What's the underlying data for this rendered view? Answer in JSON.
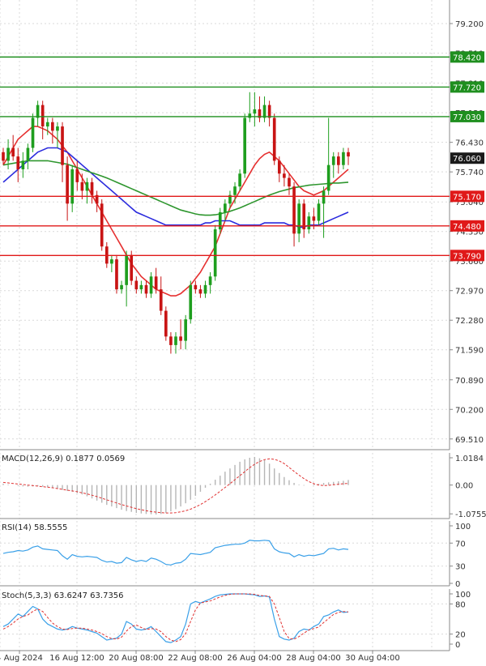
{
  "chart_data": {
    "type": "candlestick",
    "price_axis": {
      "tick_labels": [
        "79.200",
        "78.510",
        "77.810",
        "77.120",
        "76.430",
        "75.740",
        "75.040",
        "74.350",
        "73.660",
        "72.970",
        "72.280",
        "71.590",
        "70.890",
        "70.200",
        "69.510"
      ],
      "ylim": [
        69.26,
        79.75
      ]
    },
    "x_axis": {
      "tick_labels": [
        "4 Aug 2024",
        "16 Aug 12:00",
        "20 Aug 08:00",
        "22 Aug 08:00",
        "26 Aug 04:00",
        "28 Aug 04:00",
        "30 Aug 04:00"
      ]
    },
    "levels": [
      {
        "label": "78.420",
        "value": 78.42,
        "color": "#1f8f1f"
      },
      {
        "label": "77.720",
        "value": 77.72,
        "color": "#1f8f1f"
      },
      {
        "label": "77.030",
        "value": 77.03,
        "color": "#1f8f1f"
      },
      {
        "label": "75.170",
        "value": 75.17,
        "color": "#e01919"
      },
      {
        "label": "74.480",
        "value": 74.48,
        "color": "#e01919"
      },
      {
        "label": "73.790",
        "value": 73.79,
        "color": "#e01919"
      }
    ],
    "current_price": {
      "label": "76.060",
      "value": 76.06
    },
    "candles": [
      [
        76.2,
        76.3,
        75.9,
        76.0
      ],
      [
        76.0,
        76.5,
        75.8,
        76.3
      ],
      [
        76.3,
        76.6,
        76.0,
        76.1
      ],
      [
        76.1,
        76.3,
        75.5,
        75.8
      ],
      [
        75.8,
        76.2,
        75.6,
        76.0
      ],
      [
        76.0,
        76.4,
        75.8,
        76.3
      ],
      [
        76.3,
        77.1,
        76.2,
        77.0
      ],
      [
        77.0,
        77.4,
        76.8,
        77.3
      ],
      [
        77.3,
        77.4,
        76.5,
        76.8
      ],
      [
        76.8,
        77.0,
        76.6,
        76.9
      ],
      [
        76.9,
        77.0,
        76.4,
        76.7
      ],
      [
        76.7,
        76.9,
        76.3,
        76.8
      ],
      [
        76.8,
        76.9,
        75.5,
        75.9
      ],
      [
        75.9,
        76.1,
        74.6,
        75.0
      ],
      [
        75.0,
        75.9,
        74.8,
        75.8
      ],
      [
        75.8,
        76.0,
        75.3,
        75.5
      ],
      [
        75.5,
        75.7,
        75.1,
        75.3
      ],
      [
        75.3,
        75.6,
        75.0,
        75.5
      ],
      [
        75.5,
        75.6,
        75.0,
        75.2
      ],
      [
        75.2,
        75.3,
        74.8,
        75.0
      ],
      [
        75.0,
        75.1,
        73.9,
        74.0
      ],
      [
        74.0,
        74.1,
        73.5,
        73.6
      ],
      [
        73.6,
        73.8,
        73.4,
        73.7
      ],
      [
        73.7,
        73.8,
        72.9,
        73.0
      ],
      [
        73.0,
        73.2,
        72.9,
        73.1
      ],
      [
        73.1,
        73.9,
        72.6,
        73.8
      ],
      [
        73.8,
        73.9,
        73.1,
        73.2
      ],
      [
        73.2,
        73.3,
        72.9,
        73.0
      ],
      [
        73.0,
        73.2,
        72.9,
        73.1
      ],
      [
        73.1,
        73.2,
        72.8,
        72.9
      ],
      [
        72.9,
        73.4,
        72.8,
        73.3
      ],
      [
        73.3,
        73.5,
        72.9,
        73.0
      ],
      [
        73.0,
        73.3,
        72.4,
        72.5
      ],
      [
        72.5,
        72.6,
        71.8,
        71.9
      ],
      [
        71.9,
        72.0,
        71.5,
        71.7
      ],
      [
        71.7,
        72.0,
        71.5,
        71.9
      ],
      [
        71.9,
        72.3,
        71.6,
        71.8
      ],
      [
        71.8,
        72.4,
        71.6,
        72.3
      ],
      [
        72.3,
        73.2,
        72.2,
        73.1
      ],
      [
        73.1,
        73.2,
        72.9,
        73.0
      ],
      [
        73.0,
        73.1,
        72.8,
        72.9
      ],
      [
        72.9,
        73.2,
        72.8,
        73.1
      ],
      [
        73.1,
        73.4,
        72.9,
        73.3
      ],
      [
        73.3,
        74.5,
        73.2,
        74.4
      ],
      [
        74.4,
        74.9,
        74.3,
        74.8
      ],
      [
        74.8,
        75.1,
        74.6,
        75.0
      ],
      [
        75.0,
        75.3,
        74.9,
        75.2
      ],
      [
        75.2,
        75.5,
        75.0,
        75.4
      ],
      [
        75.4,
        75.8,
        75.3,
        75.7
      ],
      [
        75.7,
        77.1,
        75.6,
        77.0
      ],
      [
        77.0,
        77.6,
        76.9,
        77.1
      ],
      [
        77.1,
        77.6,
        76.8,
        77.2
      ],
      [
        77.2,
        77.5,
        76.9,
        77.0
      ],
      [
        77.0,
        77.5,
        76.9,
        77.3
      ],
      [
        77.3,
        77.4,
        76.8,
        77.0
      ],
      [
        77.0,
        77.1,
        75.9,
        76.0
      ],
      [
        76.0,
        76.1,
        75.5,
        75.7
      ],
      [
        75.7,
        75.9,
        75.4,
        75.6
      ],
      [
        75.6,
        75.7,
        75.2,
        75.4
      ],
      [
        75.4,
        75.5,
        74.0,
        74.3
      ],
      [
        74.3,
        75.1,
        74.1,
        75.0
      ],
      [
        75.0,
        75.1,
        74.2,
        74.4
      ],
      [
        74.4,
        74.8,
        74.3,
        74.7
      ],
      [
        74.7,
        74.9,
        74.4,
        74.6
      ],
      [
        74.6,
        75.1,
        74.5,
        75.0
      ],
      [
        75.0,
        75.4,
        74.2,
        75.3
      ],
      [
        75.3,
        77.0,
        75.2,
        75.9
      ],
      [
        75.9,
        76.2,
        75.6,
        76.1
      ],
      [
        76.1,
        76.2,
        75.7,
        75.9
      ],
      [
        75.9,
        76.3,
        75.8,
        76.2
      ],
      [
        76.2,
        76.3,
        75.9,
        76.1
      ]
    ],
    "macd": {
      "label": "MACD(12,26,9) 0.1877 0.0569",
      "tick_labels": [
        "1.0184",
        "0.00",
        "-1.0755"
      ],
      "ylim": [
        -1.25,
        1.2
      ],
      "hist": [
        0.05,
        0.02,
        0.0,
        -0.03,
        -0.05,
        -0.06,
        -0.05,
        -0.04,
        -0.06,
        -0.08,
        -0.11,
        -0.14,
        -0.18,
        -0.22,
        -0.25,
        -0.3,
        -0.35,
        -0.42,
        -0.5,
        -0.58,
        -0.66,
        -0.74,
        -0.8,
        -0.86,
        -0.92,
        -0.97,
        -1.0,
        -1.04,
        -1.06,
        -1.08,
        -1.09,
        -1.1,
        -1.08,
        -1.04,
        -0.98,
        -0.9,
        -0.8,
        -0.68,
        -0.55,
        -0.4,
        -0.25,
        -0.1,
        0.05,
        0.2,
        0.35,
        0.5,
        0.62,
        0.75,
        0.87,
        0.96,
        1.02,
        1.05,
        1.0,
        0.93,
        0.8,
        0.62,
        0.45,
        0.3,
        0.18,
        0.08,
        0.02,
        -0.02,
        0.0,
        0.03,
        0.05,
        0.08,
        0.1,
        0.12,
        0.14,
        0.16,
        0.19
      ],
      "signal": [
        0.1,
        0.08,
        0.06,
        0.04,
        0.02,
        0.0,
        -0.02,
        -0.04,
        -0.06,
        -0.08,
        -0.1,
        -0.13,
        -0.16,
        -0.19,
        -0.22,
        -0.25,
        -0.29,
        -0.33,
        -0.38,
        -0.43,
        -0.49,
        -0.55,
        -0.61,
        -0.67,
        -0.73,
        -0.78,
        -0.83,
        -0.88,
        -0.92,
        -0.96,
        -0.99,
        -1.01,
        -1.03,
        -1.04,
        -1.04,
        -1.03,
        -1.0,
        -0.96,
        -0.9,
        -0.82,
        -0.73,
        -0.62,
        -0.5,
        -0.37,
        -0.23,
        -0.09,
        0.05,
        0.2,
        0.35,
        0.5,
        0.65,
        0.78,
        0.88,
        0.95,
        0.98,
        0.96,
        0.9,
        0.8,
        0.66,
        0.51,
        0.37,
        0.24,
        0.13,
        0.05,
        0.0,
        -0.02,
        -0.01,
        0.01,
        0.03,
        0.05,
        0.06
      ]
    },
    "rsi": {
      "label": "RSI(14) 58.5555",
      "tick_labels": [
        "100",
        "70",
        "30",
        "0"
      ],
      "levels": [
        100,
        70,
        30,
        0
      ],
      "values": [
        52,
        54,
        55,
        57,
        56,
        58,
        63,
        65,
        60,
        59,
        58,
        57,
        48,
        42,
        50,
        47,
        46,
        47,
        46,
        45,
        40,
        37,
        38,
        35,
        36,
        45,
        41,
        38,
        40,
        38,
        44,
        42,
        38,
        33,
        32,
        35,
        36,
        42,
        52,
        51,
        50,
        52,
        54,
        62,
        64,
        66,
        67,
        68,
        68,
        70,
        75,
        74,
        74,
        75,
        74,
        60,
        55,
        53,
        52,
        46,
        50,
        47,
        49,
        48,
        50,
        52,
        60,
        61,
        58,
        60,
        59
      ]
    },
    "stoch": {
      "label": "Stoch(5,3,3) 63.6247 63.7356",
      "tick_labels": [
        "100",
        "80",
        "20",
        "0"
      ],
      "levels": [
        100,
        80,
        20,
        0
      ],
      "k": [
        35,
        40,
        50,
        60,
        55,
        65,
        75,
        70,
        50,
        40,
        35,
        30,
        28,
        30,
        35,
        32,
        30,
        28,
        25,
        22,
        15,
        8,
        10,
        12,
        20,
        45,
        40,
        30,
        28,
        30,
        35,
        25,
        15,
        5,
        3,
        8,
        15,
        40,
        80,
        85,
        82,
        86,
        90,
        95,
        98,
        99,
        100,
        100,
        100,
        100,
        99,
        98,
        95,
        96,
        94,
        50,
        15,
        10,
        8,
        12,
        25,
        30,
        28,
        35,
        40,
        55,
        58,
        64,
        68,
        63,
        64
      ],
      "d": [
        30,
        35,
        42,
        50,
        55,
        58,
        65,
        70,
        65,
        53,
        42,
        35,
        30,
        29,
        31,
        32,
        32,
        30,
        28,
        25,
        21,
        15,
        11,
        10,
        14,
        26,
        35,
        38,
        33,
        29,
        31,
        30,
        25,
        15,
        8,
        5,
        9,
        21,
        45,
        68,
        82,
        84,
        86,
        90,
        94,
        97,
        99,
        100,
        100,
        100,
        100,
        99,
        97,
        96,
        95,
        80,
        53,
        25,
        11,
        10,
        15,
        22,
        28,
        31,
        34,
        43,
        51,
        59,
        63,
        65,
        64
      ]
    },
    "moving_averages": [
      {
        "color": "#e63030",
        "values": [
          75.9,
          76.1,
          76.3,
          76.5,
          76.6,
          76.7,
          76.8,
          76.8,
          76.75,
          76.7,
          76.6,
          76.5,
          76.35,
          76.2,
          76.0,
          75.8,
          75.6,
          75.4,
          75.2,
          75.0,
          74.8,
          74.6,
          74.4,
          74.2,
          74.0,
          73.8,
          73.6,
          73.45,
          73.3,
          73.2,
          73.1,
          73.0,
          72.95,
          72.9,
          72.85,
          72.85,
          72.9,
          73.0,
          73.1,
          73.25,
          73.4,
          73.6,
          73.8,
          74.0,
          74.3,
          74.6,
          74.9,
          75.1,
          75.3,
          75.5,
          75.7,
          75.9,
          76.05,
          76.15,
          76.2,
          76.1,
          76.0,
          75.85,
          75.7,
          75.55,
          75.4,
          75.3,
          75.25,
          75.2,
          75.25,
          75.3,
          75.4,
          75.5,
          75.6,
          75.7,
          75.8
        ]
      },
      {
        "color": "#2b2bdd",
        "values": [
          75.5,
          75.6,
          75.7,
          75.8,
          75.9,
          76.0,
          76.1,
          76.2,
          76.25,
          76.3,
          76.3,
          76.3,
          76.25,
          76.2,
          76.1,
          76.0,
          75.9,
          75.8,
          75.7,
          75.6,
          75.5,
          75.4,
          75.3,
          75.2,
          75.1,
          75.0,
          74.9,
          74.8,
          74.75,
          74.7,
          74.65,
          74.6,
          74.55,
          74.5,
          74.5,
          74.5,
          74.5,
          74.5,
          74.5,
          74.5,
          74.5,
          74.55,
          74.55,
          74.6,
          74.6,
          74.6,
          74.6,
          74.55,
          74.5,
          74.5,
          74.5,
          74.5,
          74.5,
          74.55,
          74.55,
          74.55,
          74.55,
          74.55,
          74.5,
          74.5,
          74.45,
          74.45,
          74.5,
          74.5,
          74.5,
          74.55,
          74.6,
          74.65,
          74.7,
          74.75,
          74.8
        ]
      },
      {
        "color": "#2e962e",
        "values": [
          75.9,
          75.92,
          75.94,
          75.96,
          75.98,
          76.0,
          76.0,
          76.0,
          76.0,
          76.0,
          75.98,
          75.96,
          75.94,
          75.92,
          75.88,
          75.84,
          75.8,
          75.76,
          75.72,
          75.68,
          75.64,
          75.6,
          75.55,
          75.5,
          75.45,
          75.4,
          75.35,
          75.3,
          75.25,
          75.2,
          75.15,
          75.1,
          75.05,
          75.0,
          74.95,
          74.9,
          74.85,
          74.82,
          74.79,
          74.76,
          74.74,
          74.73,
          74.73,
          74.74,
          74.76,
          74.79,
          74.82,
          74.86,
          74.9,
          74.95,
          75.0,
          75.05,
          75.1,
          75.15,
          75.2,
          75.24,
          75.28,
          75.31,
          75.34,
          75.37,
          75.39,
          75.41,
          75.43,
          75.44,
          75.45,
          75.46,
          75.47,
          75.48,
          75.48,
          75.49,
          75.5
        ]
      }
    ]
  }
}
